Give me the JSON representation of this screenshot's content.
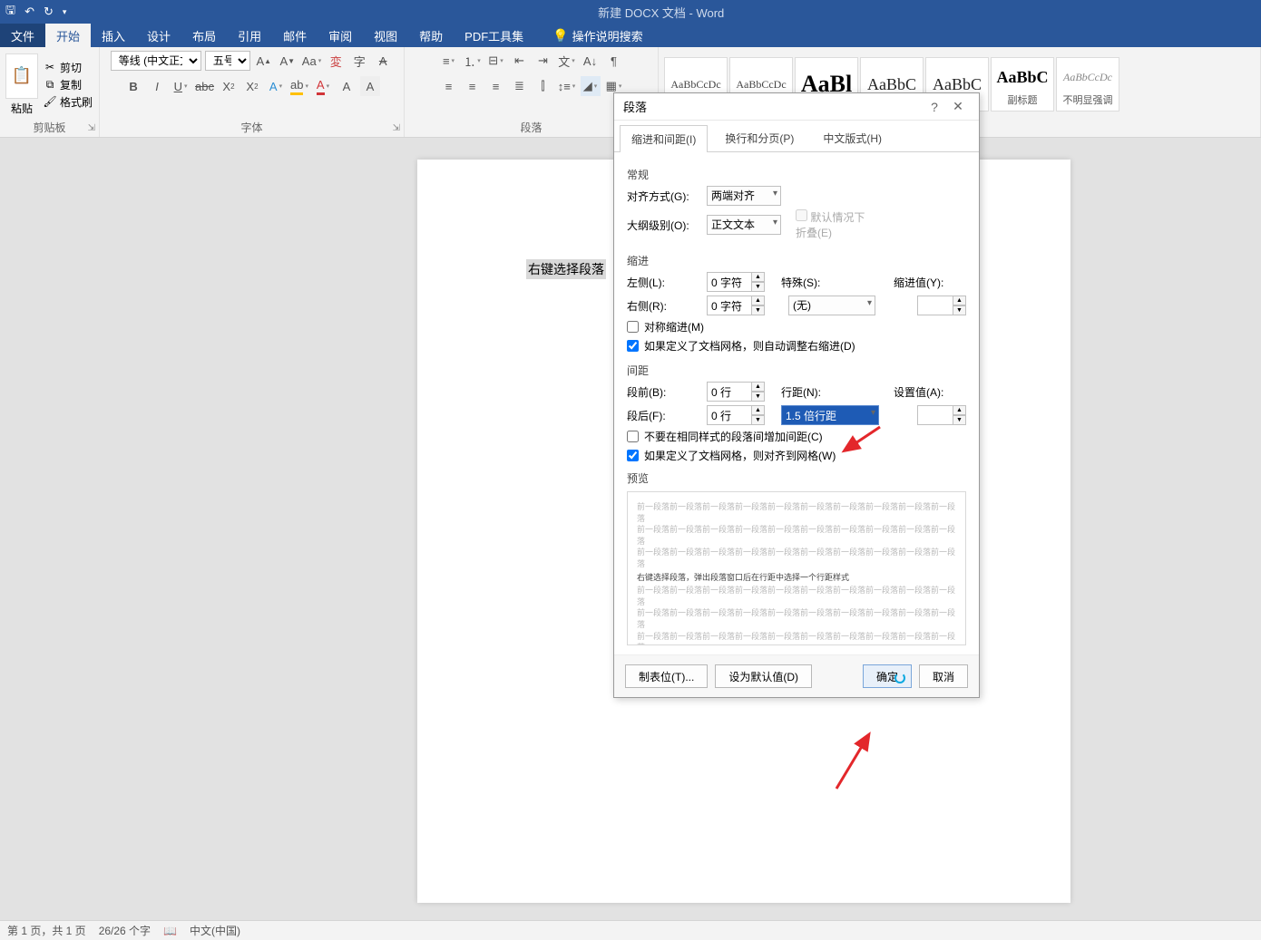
{
  "titlebar": {
    "title": "新建 DOCX 文档 - Word"
  },
  "menu": {
    "file": "文件",
    "home": "开始",
    "insert": "插入",
    "design": "设计",
    "layout": "布局",
    "references": "引用",
    "mailings": "邮件",
    "review": "审阅",
    "view": "视图",
    "help": "帮助",
    "pdf": "PDF工具集",
    "tell_me": "操作说明搜索"
  },
  "clipboard": {
    "paste": "粘贴",
    "cut": "剪切",
    "copy": "复制",
    "painter": "格式刷",
    "group": "剪贴板"
  },
  "font": {
    "name": "等线 (中文正文",
    "size": "五号",
    "group": "字体"
  },
  "paragraph": {
    "group": "段落"
  },
  "styles": {
    "group": "样式",
    "items": [
      {
        "preview": "AaBbCcDc",
        "name": ""
      },
      {
        "preview": "AaBbCcDc",
        "name": ""
      },
      {
        "preview": "AaBl",
        "name": ""
      },
      {
        "preview": "AaBbC",
        "name": ""
      },
      {
        "preview": "AaBbC",
        "name": ""
      },
      {
        "preview": "AaBbC",
        "name": ""
      },
      {
        "preview": "AaBbCcDc",
        "name": ""
      }
    ],
    "labels": {
      "subtitle": "副标题",
      "subtle": "不明显强调"
    }
  },
  "document": {
    "selected_text": "右键选择段落"
  },
  "dialog": {
    "title": "段落",
    "tabs": {
      "indent": "缩进和间距(I)",
      "pagination": "换行和分页(P)",
      "asian": "中文版式(H)"
    },
    "general": {
      "section": "常规",
      "alignment_l": "对齐方式(G):",
      "alignment_v": "两端对齐",
      "outline_l": "大纲级别(O):",
      "outline_v": "正文文本",
      "collapse": "默认情况下折叠(E)"
    },
    "indent": {
      "section": "缩进",
      "left_l": "左侧(L):",
      "left_v": "0 字符",
      "right_l": "右侧(R):",
      "right_v": "0 字符",
      "special_l": "特殊(S):",
      "special_v": "(无)",
      "by_l": "缩进值(Y):",
      "mirror": "对称缩进(M)",
      "grid": "如果定义了文档网格，则自动调整右缩进(D)"
    },
    "spacing": {
      "section": "间距",
      "before_l": "段前(B):",
      "before_v": "0 行",
      "after_l": "段后(F):",
      "after_v": "0 行",
      "line_l": "行距(N):",
      "line_v": "1.5 倍行距",
      "at_l": "设置值(A):",
      "nosame": "不要在相同样式的段落间增加间距(C)",
      "grid": "如果定义了文档网格，则对齐到网格(W)"
    },
    "preview": {
      "section": "预览",
      "dark": "右键选择段落，弹出段落窗口后在行距中选择一个行距样式",
      "grey": "前一段落前一段落前一段落前一段落前一段落前一段落前一段落前一段落前一段落前一段落"
    },
    "buttons": {
      "tabs": "制表位(T)...",
      "default": "设为默认值(D)",
      "ok": "确定",
      "cancel": "取消"
    }
  },
  "status": {
    "page": "第 1 页，共 1 页",
    "words": "26/26 个字",
    "lang": "中文(中国)"
  }
}
